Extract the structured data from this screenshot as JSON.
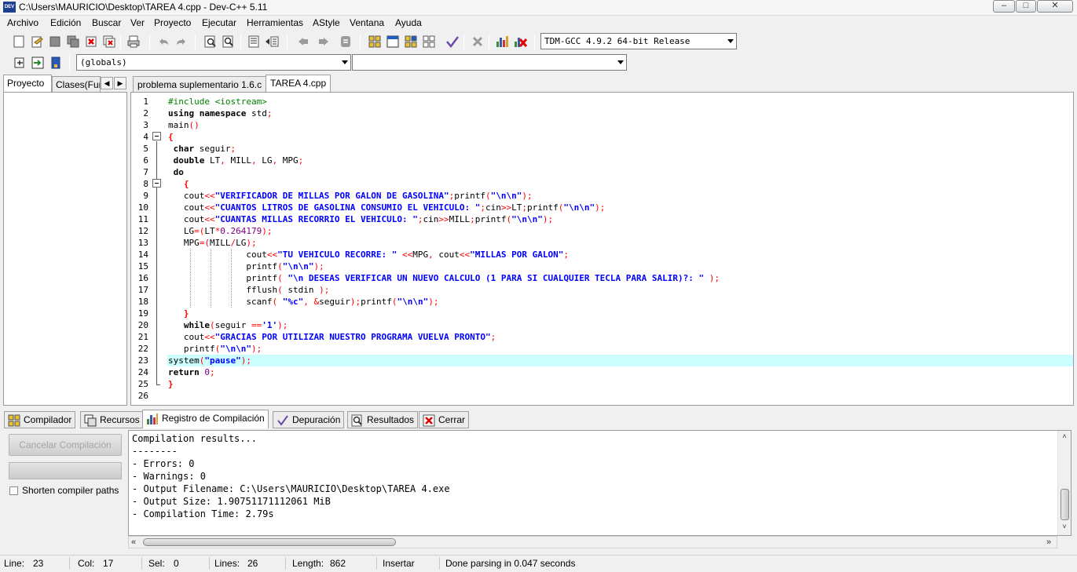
{
  "window": {
    "icon_text": "DEV",
    "title": "C:\\Users\\MAURICIO\\Desktop\\TAREA 4.cpp - Dev-C++ 5.11",
    "minimize": "–",
    "maximize": "□",
    "close": "✕"
  },
  "menu": [
    "Archivo",
    "Edición",
    "Buscar",
    "Ver",
    "Proyecto",
    "Ejecutar",
    "Herramientas",
    "AStyle",
    "Ventana",
    "Ayuda"
  ],
  "toolbar": {
    "compiler_select": "TDM-GCC 4.9.2 64-bit Release",
    "scope_select": "(globals)",
    "function_select": ""
  },
  "left_tabs": [
    "Proyecto",
    "Clases(Fun"
  ],
  "editor_tabs": [
    "problema suplementario 1.6.c",
    "TAREA 4.cpp"
  ],
  "code_lines": [
    "#include <iostream>",
    "using namespace std;",
    "main()",
    "{",
    " char seguir;",
    " double LT, MILL, LG, MPG;",
    " do",
    "   {",
    "   cout<<\"VERIFICADOR DE MILLAS POR GALON DE GASOLINA\";printf(\"\\n\\n\");",
    "   cout<<\"CUANTOS LITROS DE GASOLINA CONSUMIO EL VEHICULO: \";cin>>LT;printf(\"\\n\\n\");",
    "   cout<<\"CUANTAS MILLAS RECORRIO EL VEHICULO: \";cin>>MILL;printf(\"\\n\\n\");",
    "   LG=(LT*0.264179);",
    "   MPG=(MILL/LG);",
    "               cout<<\"TU VEHICULO RECORRE: \" <<MPG, cout<<\"MILLAS POR GALON\";",
    "               printf(\"\\n\\n\");",
    "               printf( \"\\n DESEAS VERIFICAR UN NUEVO CALCULO (1 PARA SI CUALQUIER TECLA PARA SALIR)?: \" );",
    "               fflush( stdin );",
    "               scanf( \"%c\", &seguir);printf(\"\\n\\n\");",
    "   }",
    "   while(seguir =='1');",
    "   cout<<\"GRACIAS POR UTILIZAR NUESTRO PROGRAMA VUELVA PRONTO\";",
    "   printf(\"\\n\\n\");",
    "system(\"pause\");",
    "return 0;",
    "}",
    ""
  ],
  "bottom_tabs": [
    "Compilador",
    "Recursos",
    "Registro de Compilación",
    "Depuración",
    "Resultados",
    "Cerrar"
  ],
  "compile_panel": {
    "cancel_button": "Cancelar Compilación",
    "shorten_paths": "Shorten compiler paths",
    "log": [
      "Compilation results...",
      "--------",
      "- Errors: 0",
      "- Warnings: 0",
      "- Output Filename: C:\\Users\\MAURICIO\\Desktop\\TAREA 4.exe",
      "- Output Size: 1.90751171112061 MiB",
      "- Compilation Time: 2.79s"
    ]
  },
  "status": {
    "line_label": "Line:",
    "line_value": "23",
    "col_label": "Col:",
    "col_value": "17",
    "sel_label": "Sel:",
    "sel_value": "0",
    "lines_label": "Lines:",
    "lines_value": "26",
    "length_label": "Length:",
    "length_value": "862",
    "mode": "Insertar",
    "message": "Done parsing in 0.047 seconds"
  }
}
